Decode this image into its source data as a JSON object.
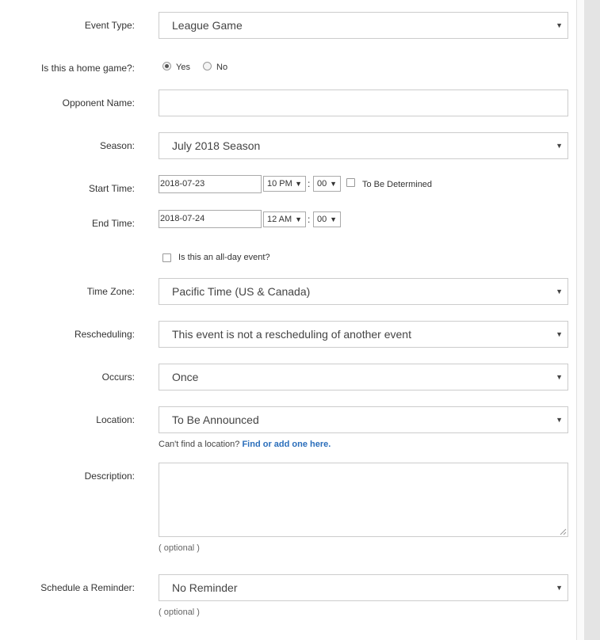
{
  "form": {
    "event_type": {
      "label": "Event Type:",
      "value": "League Game"
    },
    "home_game": {
      "label": "Is this a home game?:",
      "options": [
        "Yes",
        "No"
      ],
      "selected": "Yes"
    },
    "opponent": {
      "label": "Opponent Name:",
      "value": ""
    },
    "season": {
      "label": "Season:",
      "value": "July 2018 Season"
    },
    "start_time": {
      "label": "Start Time:",
      "date": "2018-07-23",
      "hour": "10 PM",
      "minute": "00",
      "tbd_label": "To Be Determined",
      "colon": ":"
    },
    "end_time": {
      "label": "End Time:",
      "date": "2018-07-24",
      "hour": "12 AM",
      "minute": "00",
      "colon": ":"
    },
    "all_day": {
      "label": "Is this an all-day event?"
    },
    "time_zone": {
      "label": "Time Zone:",
      "value": "Pacific Time (US & Canada)"
    },
    "rescheduling": {
      "label": "Rescheduling:",
      "value": "This event is not a rescheduling of another event"
    },
    "occurs": {
      "label": "Occurs:",
      "value": "Once"
    },
    "location": {
      "label": "Location:",
      "value": "To Be Announced",
      "help_text": "Can't find a location?",
      "help_link": "Find or add one here."
    },
    "description": {
      "label": "Description:",
      "value": "",
      "hint": "( optional )"
    },
    "reminder": {
      "label": "Schedule a Reminder:",
      "value": "No Reminder",
      "hint": "( optional )"
    }
  },
  "icons": {
    "dropdown_arrow": "▼"
  }
}
